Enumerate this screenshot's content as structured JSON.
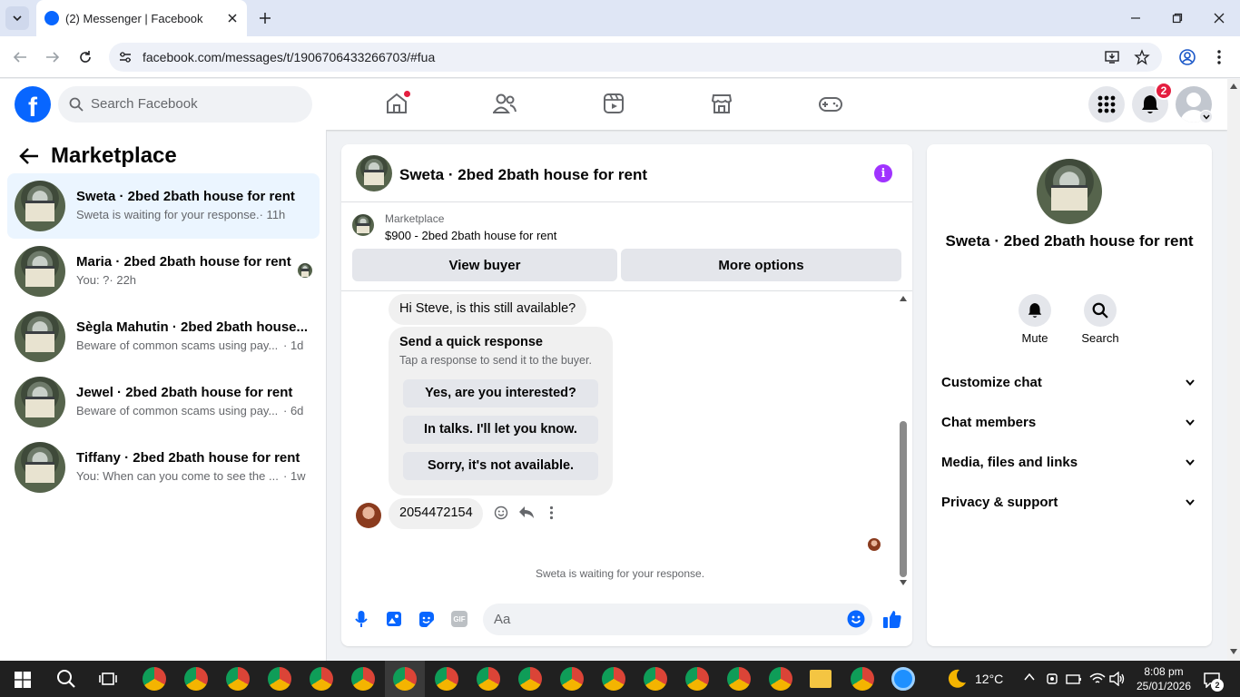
{
  "browser": {
    "tab_title": "(2) Messenger | Facebook",
    "url": "facebook.com/messages/t/1906706433266703/#fua"
  },
  "facebook": {
    "search_placeholder": "Search Facebook",
    "notification_count": "2"
  },
  "sidebar": {
    "title": "Marketplace",
    "conversations": [
      {
        "name": "Sweta · 2bed 2bath house for rent",
        "preview": "Sweta is waiting for your response.",
        "time": "· 11h"
      },
      {
        "name": "Maria · 2bed 2bath house for rent",
        "preview": "You: ?",
        "time": "· 22h"
      },
      {
        "name": "Sègla Mahutin · 2bed 2bath house...",
        "preview": "Beware of common scams using pay...",
        "time": "· 1d"
      },
      {
        "name": "Jewel · 2bed 2bath house for rent",
        "preview": "Beware of common scams using pay...",
        "time": "· 6d"
      },
      {
        "name": "Tiffany · 2bed 2bath house for rent",
        "preview": "You: When can you come to see the ...",
        "time": "· 1w"
      }
    ]
  },
  "chat": {
    "header_title": "Sweta · 2bed 2bath house for rent",
    "listing_source": "Marketplace",
    "listing_title": "$900 - 2bed 2bath house for rent",
    "view_buyer": "View buyer",
    "more_options": "More options",
    "first_message": "Hi Steve, is this still available?",
    "quick_response_title": "Send a quick response",
    "quick_response_sub": "Tap a response to send it to the buyer.",
    "quick_responses": [
      "Yes, are you interested?",
      "In talks. I'll let you know.",
      "Sorry, it's not available."
    ],
    "phone_message": "2054472154",
    "waiting_note": "Sweta is waiting for your response.",
    "composer_placeholder": "Aa"
  },
  "details": {
    "title": "Sweta · 2bed 2bath house for rent",
    "mute": "Mute",
    "search": "Search",
    "sections": [
      "Customize chat",
      "Chat members",
      "Media, files and links",
      "Privacy & support"
    ]
  },
  "taskbar": {
    "weather": "12°C",
    "time": "8:08 pm",
    "date": "25/01/2026",
    "notif_badge": "2"
  },
  "colors": {
    "facebook_blue": "#0866ff",
    "messenger_purple": "#a033ff",
    "notification_red": "#e41e3f"
  }
}
